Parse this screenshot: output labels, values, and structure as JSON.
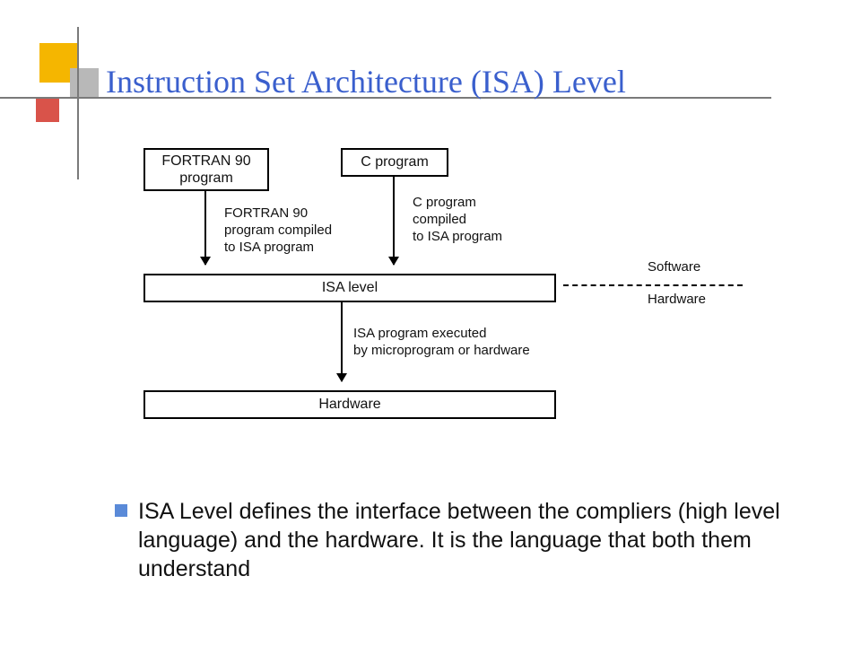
{
  "title": "Instruction Set Architecture (ISA) Level",
  "diagram": {
    "boxes": {
      "fortran": "FORTRAN 90\nprogram",
      "cprog": "C program",
      "isa": "ISA level",
      "hardware": "Hardware"
    },
    "labels": {
      "fortran_compiled": "FORTRAN 90\nprogram compiled\nto ISA program",
      "c_compiled": "C program\ncompiled\nto ISA program",
      "executed": "ISA program executed\nby microprogram or hardware",
      "software": "Software",
      "hardware_side": "Hardware"
    }
  },
  "bullet": "ISA Level defines the interface between the compliers (high level language) and the hardware. It is the language that both them understand"
}
